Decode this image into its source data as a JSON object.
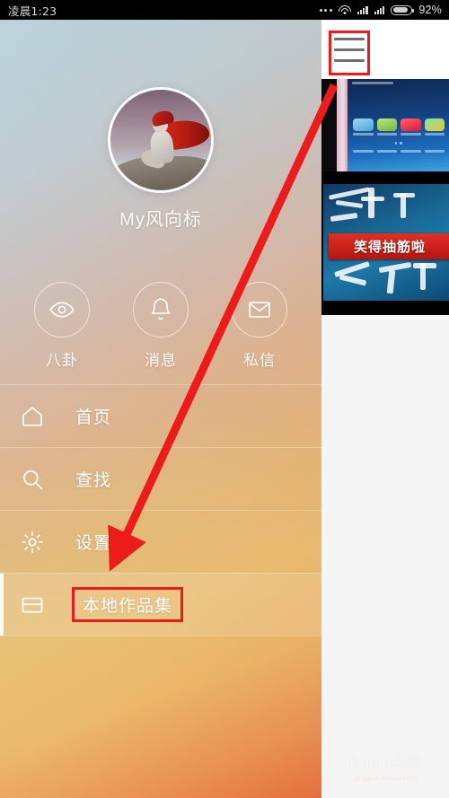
{
  "statusbar": {
    "time": "凌晨1:23",
    "battery_pct": "92%",
    "icons": [
      "more-dots-icon",
      "wifi-icon",
      "signal-icon",
      "signal-icon",
      "battery-icon"
    ]
  },
  "drawer": {
    "profile": {
      "username": "My风向标",
      "avatar_alt": "caped-figure-on-rock-avatar"
    },
    "quick_actions": [
      {
        "icon": "eye-icon",
        "label": "八卦"
      },
      {
        "icon": "bell-icon",
        "label": "消息"
      },
      {
        "icon": "envelope-icon",
        "label": "私信"
      }
    ],
    "menu": [
      {
        "icon": "home-icon",
        "label": "首页",
        "active": false
      },
      {
        "icon": "search-icon",
        "label": "查找",
        "active": false
      },
      {
        "icon": "gear-icon",
        "label": "设置",
        "active": false
      },
      {
        "icon": "folder-icon",
        "label": "本地作品集",
        "active": true
      }
    ]
  },
  "content": {
    "menu_button": "hamburger-menu-icon",
    "thumbnails": [
      {
        "name": "phone-homescreen-thumbnail",
        "caption": ""
      },
      {
        "name": "calligraphy-video-thumbnail",
        "caption": "笑得抽筋啦"
      }
    ],
    "watermark": {
      "main": "Baidu经验",
      "sub": "jingyan.baidu.com"
    }
  },
  "annotations": {
    "highlight_boxes": [
      "hamburger-menu-icon",
      "本地作品集"
    ],
    "arrow": {
      "from": "hamburger-menu-icon",
      "to": "本地作品集",
      "color": "#ee1b1b"
    }
  },
  "colors": {
    "annotation_red": "#ee1b1b",
    "drawer_top": "#b5ced9",
    "drawer_bottom": "#e5703f",
    "statusbar_bg": "#000000"
  }
}
